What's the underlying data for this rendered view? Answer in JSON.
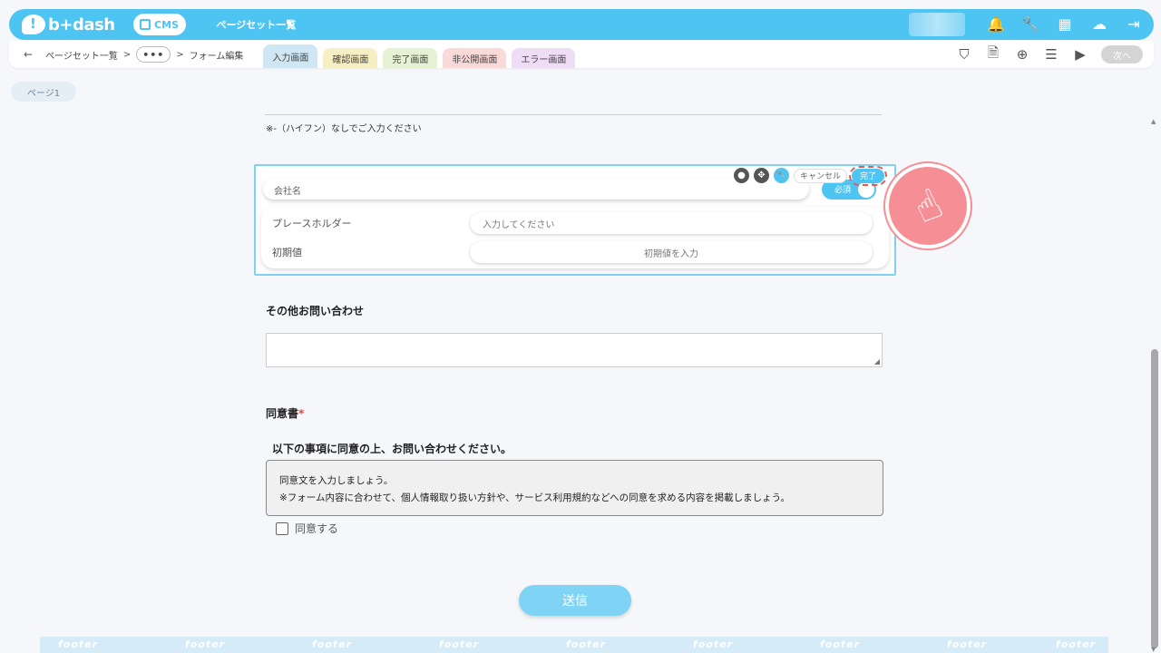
{
  "header": {
    "brand": "b+dash",
    "cms_label": "CMS",
    "page_title": "ページセット一覧"
  },
  "breadcrumb": {
    "back": "←",
    "item1": "ページセット一覧",
    "sep": ">",
    "dots": "•••",
    "item2": "フォーム編集"
  },
  "tabs": [
    {
      "label": "入力画面"
    },
    {
      "label": "確認画面"
    },
    {
      "label": "完了画面"
    },
    {
      "label": "非公開画面"
    },
    {
      "label": "エラー画面"
    }
  ],
  "next_button": "次へ",
  "page_pill": "ページ1",
  "form": {
    "note": "※-（ハイフン）なしでご入力ください",
    "edit_field": {
      "name": "会社名",
      "required_label": "必須",
      "cancel_label": "キャンセル",
      "done_label": "完了",
      "placeholder_label": "プレースホルダー",
      "placeholder_value": "入力してください",
      "initial_label": "初期値",
      "initial_value": "初期値を入力"
    },
    "other_inquiry_label": "その他お問い合わせ",
    "consent_label": "同意書",
    "consent_required_mark": "*",
    "consent_title": "以下の事項に同意の上、お問い合わせください。",
    "consent_line1": "同意文を入力しましょう。",
    "consent_line2": "※フォーム内容に合わせて、個人情報取り扱い方針や、サービス利用規約などへの同意を求める内容を掲載しましょう。",
    "agree_checkbox_label": "同意する",
    "submit_label": "送信"
  },
  "footer": {
    "watermark": "footer"
  },
  "colors": {
    "brand": "#4ec4f2",
    "highlight_circle": "#f58f95",
    "required_star": "#e04545"
  }
}
